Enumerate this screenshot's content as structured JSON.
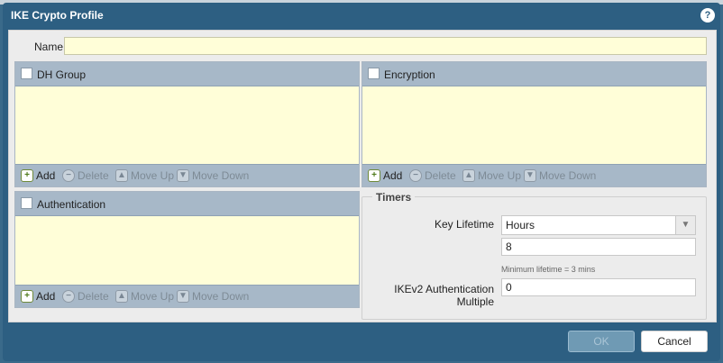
{
  "dialog": {
    "title": "IKE Crypto Profile",
    "help": "?"
  },
  "name": {
    "label": "Name",
    "value": ""
  },
  "panels": {
    "dh_group": {
      "header": "DH Group"
    },
    "encryption": {
      "header": "Encryption"
    },
    "authentication": {
      "header": "Authentication"
    }
  },
  "toolbar": {
    "add": "Add",
    "delete": "Delete",
    "move_up": "Move Up",
    "move_down": "Move Down",
    "add_icon": "plus-icon",
    "delete_icon": "minus-circle-icon",
    "move_up_icon": "arrow-up-icon",
    "move_down_icon": "arrow-down-icon"
  },
  "timers": {
    "legend": "Timers",
    "key_lifetime_label": "Key Lifetime",
    "key_lifetime_unit": "Hours",
    "key_lifetime_value": "8",
    "min_hint": "Minimum lifetime = 3 mins",
    "ikev2_label_line1": "IKEv2 Authentication",
    "ikev2_label_line2": "Multiple",
    "ikev2_value": "0"
  },
  "buttons": {
    "ok": "OK",
    "cancel": "Cancel"
  },
  "colors": {
    "dialog_blue": "#2d5f82",
    "list_yellow": "#fffed8",
    "header_gray_blue": "#a7b8c8"
  }
}
